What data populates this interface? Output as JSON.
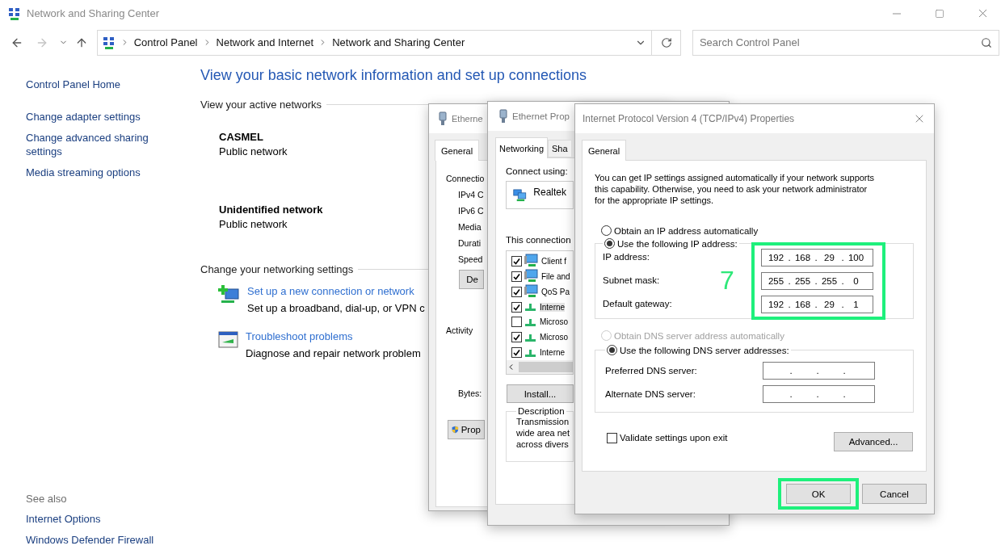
{
  "window": {
    "title": "Network and Sharing Center"
  },
  "address_bar": {
    "breadcrumbs": [
      "Control Panel",
      "Network and Internet",
      "Network and Sharing Center"
    ]
  },
  "search": {
    "placeholder": "Search Control Panel"
  },
  "sidebar": {
    "items": [
      "Control Panel Home",
      "Change adapter settings",
      "Change advanced sharing settings",
      "Media streaming options"
    ],
    "see_also": {
      "heading": "See also",
      "items": [
        "Internet Options",
        "Windows Defender Firewall"
      ]
    }
  },
  "main": {
    "heading": "View your basic network information and set up connections",
    "active_networks": {
      "heading": "View your active networks",
      "networks": [
        {
          "name": "CASMEL",
          "type": "Public network"
        },
        {
          "name": "Unidentified network",
          "type": "Public network"
        }
      ]
    },
    "settings": {
      "heading": "Change your networking settings",
      "tasks": [
        {
          "kind": "setup",
          "link": "Set up a new connection or network",
          "description": "Set up a broadband, dial-up, or VPN c"
        },
        {
          "kind": "troubleshoot",
          "link": "Troubleshoot problems",
          "description": "Diagnose and repair network problem"
        }
      ]
    }
  },
  "status_dialog": {
    "title": "Etherne",
    "tabs": [
      {
        "label": "General",
        "selected": true
      }
    ],
    "section": "Connectio",
    "rows": [
      "IPv4 C",
      "IPv6 C",
      "Media",
      "Durati",
      "Speed"
    ],
    "details_button": "De",
    "activity": "Activity",
    "bytes": "Bytes:",
    "properties_button": "Prop"
  },
  "properties_dialog": {
    "title": "Ethernet Prop",
    "tabs": [
      {
        "label": "Networking",
        "selected": true
      },
      {
        "label": "Sha",
        "selected": false
      }
    ],
    "connect_using": "Connect using:",
    "adapter": "Realtek",
    "components_label": "This connection",
    "components": [
      {
        "kind": "client",
        "label": "Client f",
        "checked": true,
        "selected": false
      },
      {
        "kind": "service",
        "label": "File and",
        "checked": true,
        "selected": false
      },
      {
        "kind": "service",
        "label": "QoS Pa",
        "checked": true,
        "selected": false
      },
      {
        "kind": "protocol",
        "label": "Interne",
        "checked": true,
        "selected": true
      },
      {
        "kind": "protocol",
        "label": "Microso",
        "checked": false,
        "selected": false
      },
      {
        "kind": "protocol",
        "label": "Microso",
        "checked": true,
        "selected": false
      },
      {
        "kind": "protocol",
        "label": "Interne",
        "checked": true,
        "selected": false
      }
    ],
    "install_button": "Install...",
    "description": {
      "legend": "Description",
      "lines": [
        "Transmission",
        "wide area net",
        "across divers"
      ]
    }
  },
  "ipv4_dialog": {
    "title": "Internet Protocol Version 4 (TCP/IPv4) Properties",
    "tabs": [
      {
        "label": "General",
        "selected": true
      }
    ],
    "intro_lines": [
      "You can get IP settings assigned automatically if your network supports",
      "this capability. Otherwise, you need to ask your network administrator",
      "for the appropriate IP settings."
    ],
    "ip_mode": [
      {
        "label": "Obtain an IP address automatically",
        "selected": false,
        "disabled": false
      },
      {
        "label": "Use the following IP address:",
        "selected": true,
        "disabled": false
      }
    ],
    "ip_group": {
      "highlighted": true,
      "annotation": "7",
      "fields": [
        {
          "label": "IP address:",
          "octets": [
            "192",
            "168",
            "29",
            "100"
          ]
        },
        {
          "label": "Subnet mask:",
          "octets": [
            "255",
            "255",
            "255",
            "0"
          ]
        },
        {
          "label": "Default gateway:",
          "octets": [
            "192",
            "168",
            "29",
            "1"
          ]
        }
      ]
    },
    "dns_mode": [
      {
        "label": "Obtain DNS server address automatically",
        "selected": false,
        "disabled": true
      },
      {
        "label": "Use the following DNS server addresses:",
        "selected": true,
        "disabled": false
      }
    ],
    "dns_fields": [
      {
        "label": "Preferred DNS server:"
      },
      {
        "label": "Alternate DNS server:"
      }
    ],
    "octet_separator": ".",
    "validate": {
      "label": "Validate settings upon exit",
      "checked": false
    },
    "advanced_button": "Advanced...",
    "buttons": [
      {
        "label": "OK",
        "highlighted": true
      },
      {
        "label": "Cancel",
        "highlighted": false
      }
    ]
  }
}
